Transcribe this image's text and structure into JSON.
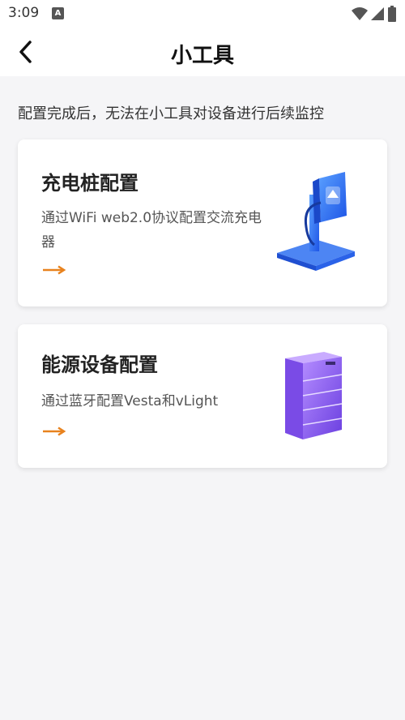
{
  "status_bar": {
    "time": "3:09",
    "icons": [
      "notification-a-icon",
      "wifi-icon",
      "signal-icon",
      "battery-icon"
    ]
  },
  "header": {
    "title": "小工具",
    "back_icon": "chevron-left-icon"
  },
  "notice": "配置完成后，无法在小工具对设备进行后续监控",
  "cards": [
    {
      "title": "充电桩配置",
      "description": "通过WiFi web2.0协议配置交流充电器",
      "arrow_icon": "arrow-right-icon",
      "illustration": "ev-charger-icon"
    },
    {
      "title": "能源设备配置",
      "description": "通过蓝牙配置Vesta和vLight",
      "arrow_icon": "arrow-right-icon",
      "illustration": "battery-cabinet-icon"
    }
  ],
  "colors": {
    "accent_arrow": "#e8821e",
    "charger_blue": "#2b6ef5",
    "cabinet_purple": "#8a5cf0",
    "background": "#f5f5f7"
  }
}
